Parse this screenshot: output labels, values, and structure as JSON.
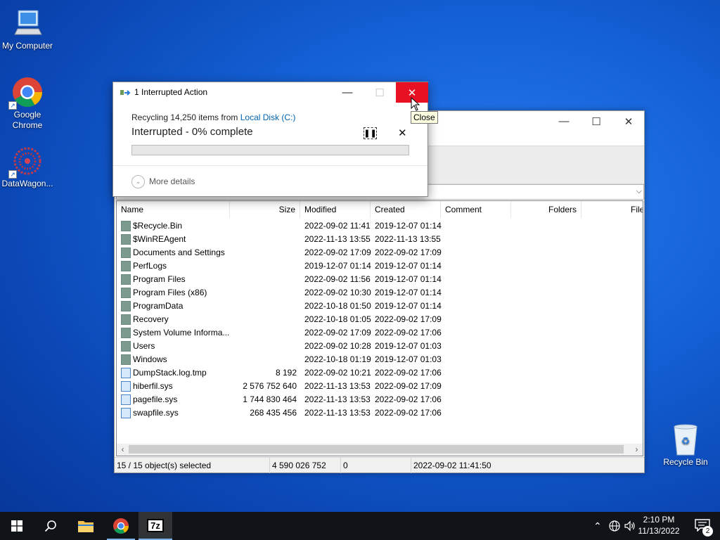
{
  "desktop": {
    "icons": [
      {
        "label": "My Computer"
      },
      {
        "label": "Google Chrome"
      },
      {
        "label": "DataWagon..."
      },
      {
        "label": "Recycle Bin"
      }
    ]
  },
  "dialog": {
    "title": "1 Interrupted Action",
    "line1_prefix": "Recycling 14,250 items from ",
    "line1_link": "Local Disk (C:)",
    "status": "Interrupted - 0% complete",
    "progress_percent": 0,
    "more_details": "More details",
    "tooltip": "Close",
    "accent": "#e81123"
  },
  "filemanager": {
    "columns": [
      "Name",
      "Size",
      "Modified",
      "Created",
      "Comment",
      "Folders",
      "File"
    ],
    "rows": [
      {
        "name": "$Recycle.Bin",
        "size": "",
        "modified": "2022-09-02 11:41",
        "created": "2019-12-07 01:14",
        "type": "folder"
      },
      {
        "name": "$WinREAgent",
        "size": "",
        "modified": "2022-11-13 13:55",
        "created": "2022-11-13 13:55",
        "type": "folder"
      },
      {
        "name": "Documents and Settings",
        "size": "",
        "modified": "2022-09-02 17:09",
        "created": "2022-09-02 17:09",
        "type": "folder"
      },
      {
        "name": "PerfLogs",
        "size": "",
        "modified": "2019-12-07 01:14",
        "created": "2019-12-07 01:14",
        "type": "folder"
      },
      {
        "name": "Program Files",
        "size": "",
        "modified": "2022-09-02 11:56",
        "created": "2019-12-07 01:14",
        "type": "folder"
      },
      {
        "name": "Program Files (x86)",
        "size": "",
        "modified": "2022-09-02 10:30",
        "created": "2019-12-07 01:14",
        "type": "folder"
      },
      {
        "name": "ProgramData",
        "size": "",
        "modified": "2022-10-18 01:50",
        "created": "2019-12-07 01:14",
        "type": "folder"
      },
      {
        "name": "Recovery",
        "size": "",
        "modified": "2022-10-18 01:05",
        "created": "2022-09-02 17:09",
        "type": "folder"
      },
      {
        "name": "System Volume Informa...",
        "size": "",
        "modified": "2022-09-02 17:09",
        "created": "2022-09-02 17:06",
        "type": "folder"
      },
      {
        "name": "Users",
        "size": "",
        "modified": "2022-09-02 10:28",
        "created": "2019-12-07 01:03",
        "type": "folder"
      },
      {
        "name": "Windows",
        "size": "",
        "modified": "2022-10-18 01:19",
        "created": "2019-12-07 01:03",
        "type": "folder"
      },
      {
        "name": "DumpStack.log.tmp",
        "size": "8 192",
        "modified": "2022-09-02 10:21",
        "created": "2022-09-02 17:06",
        "type": "file"
      },
      {
        "name": "hiberfil.sys",
        "size": "2 576 752 640",
        "modified": "2022-11-13 13:53",
        "created": "2022-09-02 17:09",
        "type": "file"
      },
      {
        "name": "pagefile.sys",
        "size": "1 744 830 464",
        "modified": "2022-11-13 13:53",
        "created": "2022-09-02 17:06",
        "type": "file"
      },
      {
        "name": "swapfile.sys",
        "size": "268 435 456",
        "modified": "2022-11-13 13:53",
        "created": "2022-09-02 17:06",
        "type": "file"
      }
    ],
    "status": {
      "selected": "15 / 15 object(s) selected",
      "total_size": "4 590 026 752",
      "packed": "0",
      "date": "2022-09-02 11:41:50"
    }
  },
  "taskbar": {
    "time": "2:10 PM",
    "date": "11/13/2022",
    "notifications": "2",
    "sevenzip_label": "7z"
  }
}
